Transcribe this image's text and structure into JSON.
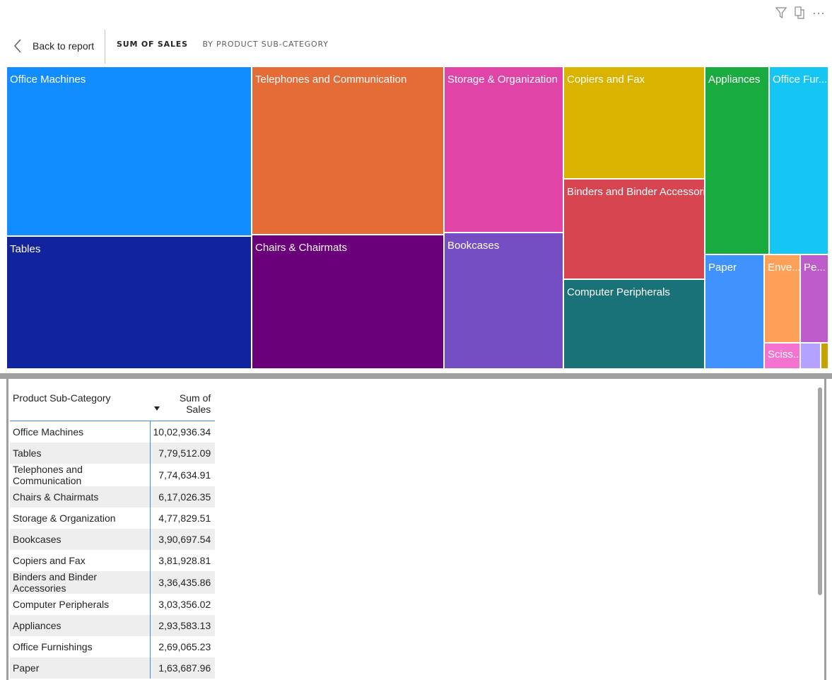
{
  "header": {
    "back_label": "Back to report",
    "measure_label": "SUM OF SALES",
    "dimension_label": "BY PRODUCT SUB-CATEGORY"
  },
  "toolbar": {
    "icons": [
      "filter-icon",
      "focus-mode-icon",
      "more-options-icon"
    ],
    "more_glyph": "···"
  },
  "treemap": {
    "tiles": [
      {
        "label": "Office Machines",
        "color": "#118DFF"
      },
      {
        "label": "Tables",
        "color": "#12239E"
      },
      {
        "label": "Telephones and Communication",
        "color": "#E66C37"
      },
      {
        "label": "Chairs & Chairmats",
        "color": "#6B007B"
      },
      {
        "label": "Storage & Organization",
        "color": "#E044A7"
      },
      {
        "label": "Bookcases",
        "color": "#744EC2"
      },
      {
        "label": "Copiers and Fax",
        "color": "#D9B300"
      },
      {
        "label": "Binders and Binder Accessories",
        "color": "#D64550"
      },
      {
        "label": "Computer Peripherals",
        "color": "#197278"
      },
      {
        "label": "Appliances",
        "color": "#1AAB40"
      },
      {
        "label": "Office Fur...",
        "color": "#15C6F4"
      },
      {
        "label": "Paper",
        "color": "#4092FF"
      },
      {
        "label": "Enve...",
        "color": "#FFA058"
      },
      {
        "label": "Pe...",
        "color": "#BE5DC9"
      },
      {
        "label": "Sciss...",
        "color": "#F472D0"
      },
      {
        "label": "",
        "color": "#B5A1FF"
      },
      {
        "label": "",
        "color": "#C4A200"
      }
    ]
  },
  "table": {
    "col_category": "Product Sub-Category",
    "col_value": "Sum of Sales",
    "rows": [
      {
        "category": "Office Machines",
        "value": "10,02,936.34"
      },
      {
        "category": "Tables",
        "value": "7,79,512.09"
      },
      {
        "category": "Telephones and Communication",
        "value": "7,74,634.91"
      },
      {
        "category": "Chairs & Chairmats",
        "value": "6,17,026.35"
      },
      {
        "category": "Storage & Organization",
        "value": "4,77,829.51"
      },
      {
        "category": "Bookcases",
        "value": "3,90,697.54"
      },
      {
        "category": "Copiers and Fax",
        "value": "3,81,928.81"
      },
      {
        "category": "Binders and Binder Accessories",
        "value": "3,36,435.86"
      },
      {
        "category": "Computer Peripherals",
        "value": "3,03,356.02"
      },
      {
        "category": "Appliances",
        "value": "2,93,583.13"
      },
      {
        "category": "Office Furnishings",
        "value": "2,69,065.23"
      },
      {
        "category": "Paper",
        "value": "1,63,687.96"
      }
    ]
  }
}
